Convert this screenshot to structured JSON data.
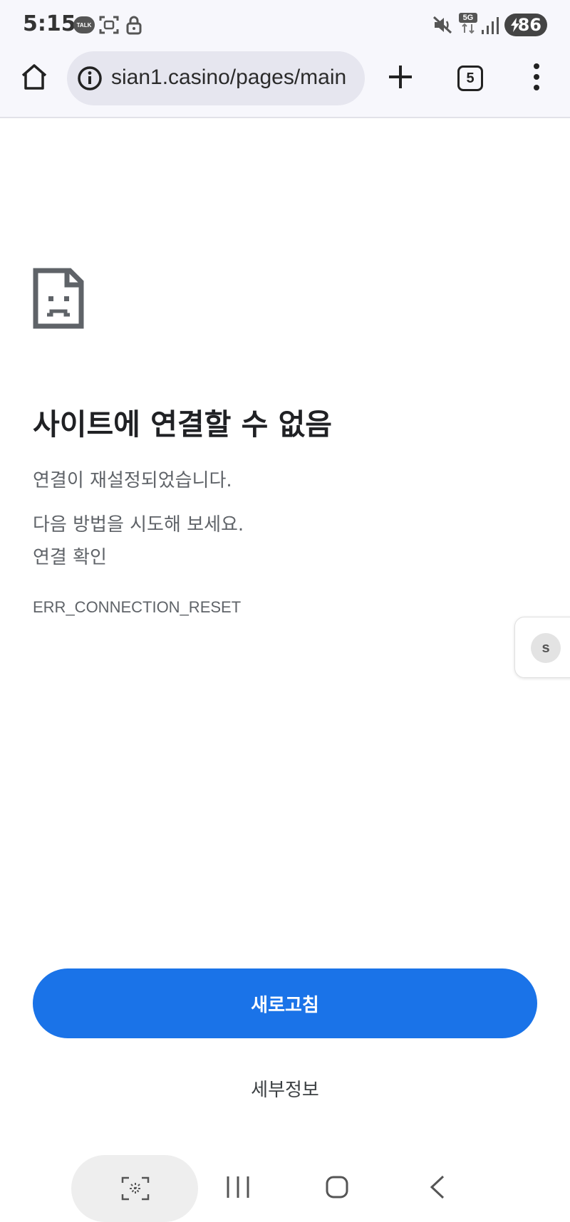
{
  "status_bar": {
    "time": "5:15",
    "talk_badge": "TALK",
    "network": "5G",
    "battery": "86",
    "icons": [
      "talk-icon",
      "screenshot-icon",
      "lock-icon",
      "mute-icon",
      "network-5g-icon",
      "signal-icon",
      "battery-icon"
    ]
  },
  "toolbar": {
    "url": "sian1.casino/pages/main",
    "tab_count": "5",
    "icons": [
      "home-icon",
      "info-icon",
      "plus-icon",
      "tab-switcher-icon",
      "more-vert-icon"
    ]
  },
  "error": {
    "title": "사이트에 연결할 수 없음",
    "message": "연결이 재설정되었습니다.",
    "suggestion_intro": "다음 방법을 시도해 보세요.",
    "suggestion": "연결 확인",
    "code": "ERR_CONNECTION_RESET"
  },
  "side_panel": {
    "avatar_letter": "s"
  },
  "actions": {
    "reload": "새로고침",
    "details": "세부정보"
  },
  "nav_bar": {
    "icons": [
      "scan-icon",
      "recents-icon",
      "home-nav-icon",
      "back-icon"
    ]
  },
  "colors": {
    "accent": "#1a73e8",
    "toolbar_bg": "#f7f7fc",
    "url_box_bg": "#e6e6ef",
    "text_primary": "#202124",
    "text_secondary": "#5f6368"
  }
}
